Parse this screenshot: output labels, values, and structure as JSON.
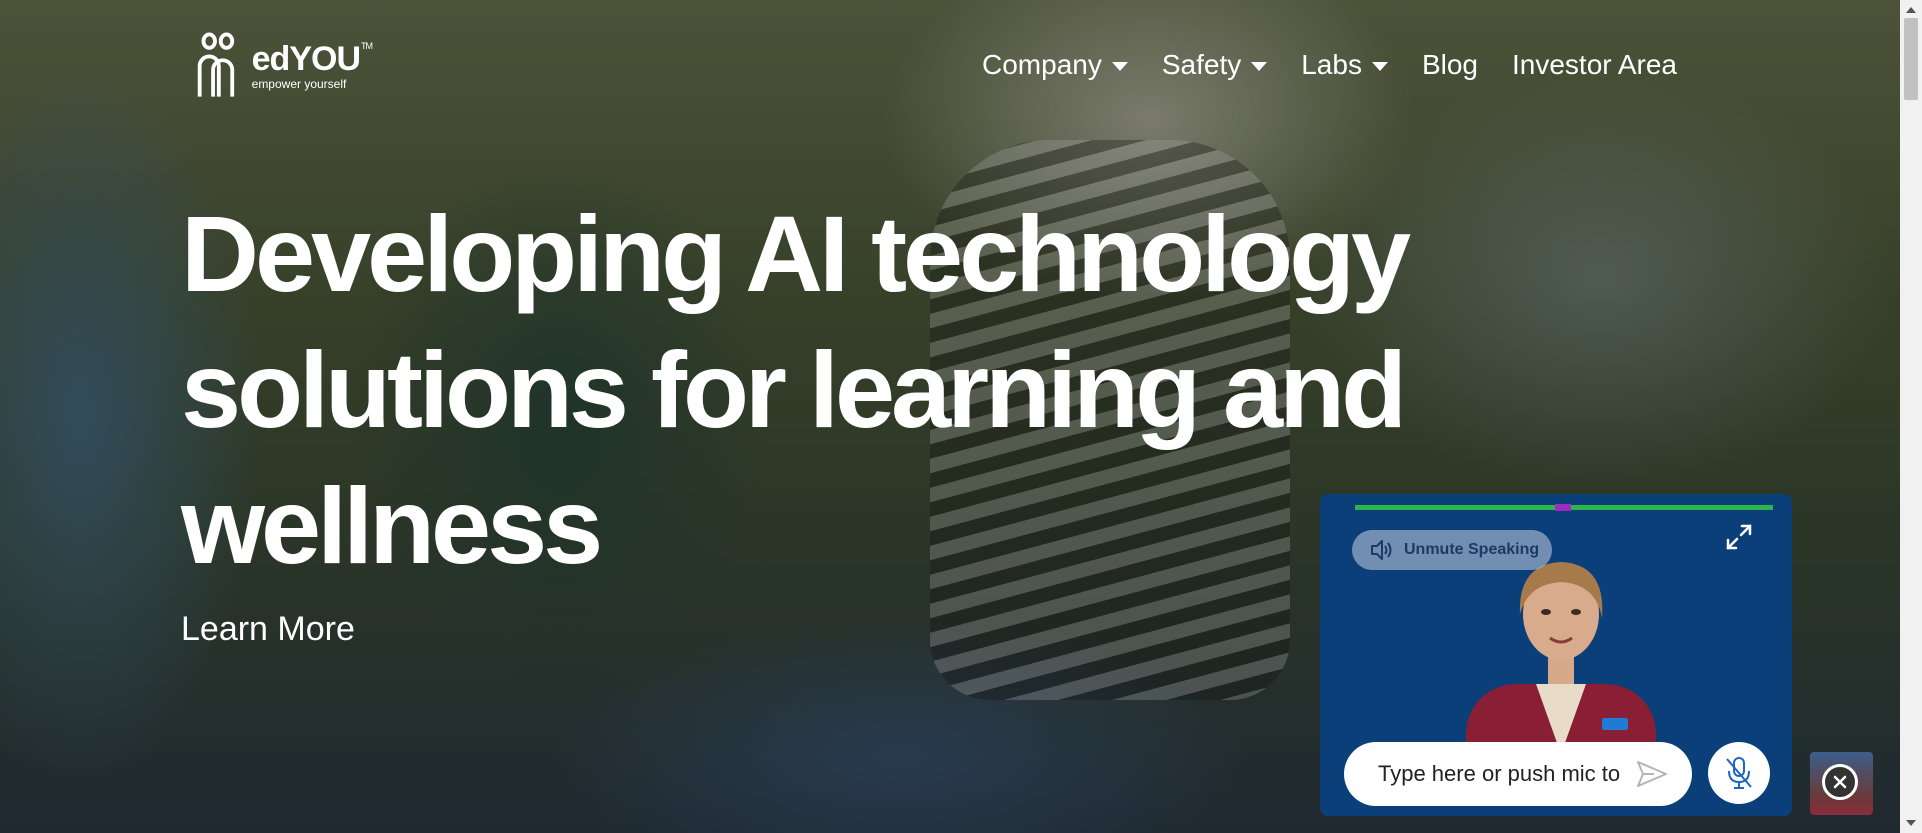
{
  "header": {
    "logo": {
      "name": "edYOU",
      "trademark": "TM",
      "tagline": "empower yourself"
    },
    "nav": [
      {
        "label": "Company",
        "has_dropdown": true
      },
      {
        "label": "Safety",
        "has_dropdown": true
      },
      {
        "label": "Labs",
        "has_dropdown": true
      },
      {
        "label": "Blog",
        "has_dropdown": false
      },
      {
        "label": "Investor Area",
        "has_dropdown": false
      }
    ]
  },
  "hero": {
    "title_lines": [
      "Developing AI technology",
      "solutions for learning and",
      "wellness"
    ],
    "cta_label": "Learn More"
  },
  "chat": {
    "unmute_label": "Unmute Speaking",
    "input_placeholder": "Type here or push mic to",
    "icons": [
      "speaker-icon",
      "expand-icon",
      "send-icon",
      "mic-off-icon",
      "close-icon"
    ]
  },
  "colors": {
    "chat_bg": "#0b3f7a",
    "progress_green": "#2cb64a",
    "progress_marker": "#a02bc4",
    "text_white": "#ffffff"
  }
}
